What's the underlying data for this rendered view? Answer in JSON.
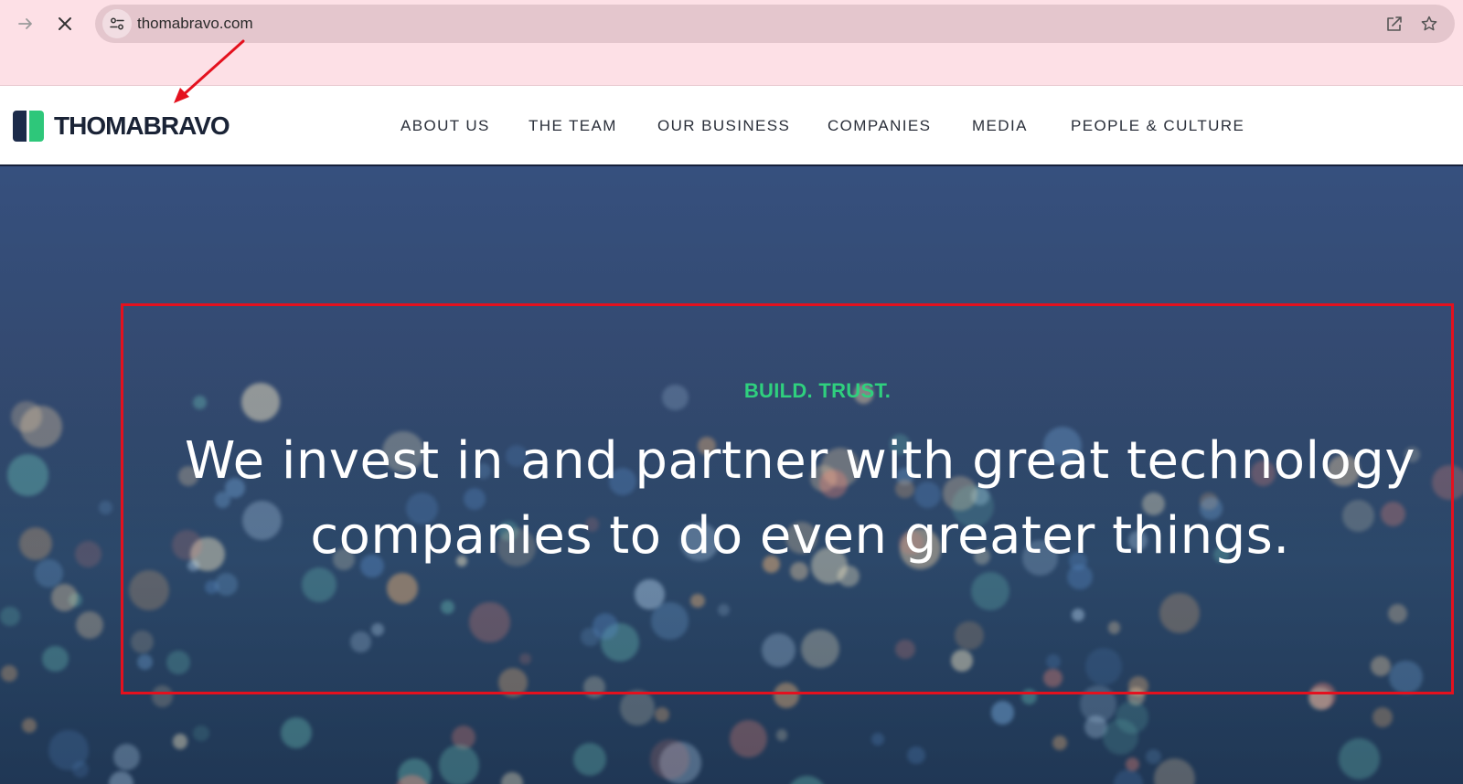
{
  "browser": {
    "url": "thomabravo.com"
  },
  "site": {
    "logo_text": "THOMABRAVO",
    "brand_colors": {
      "dark": "#1c2b4a",
      "green": "#2ec77a"
    },
    "nav": [
      {
        "label": "ABOUT US"
      },
      {
        "label": "THE TEAM"
      },
      {
        "label": "OUR BUSINESS"
      },
      {
        "label": "COMPANIES"
      },
      {
        "label": "MEDIA"
      },
      {
        "label": "PEOPLE & CULTURE"
      }
    ]
  },
  "hero": {
    "tagline": "BUILD. TRUST.",
    "headline_line1": "We invest in and partner with great technology",
    "headline_line2": "companies to do even greater things.",
    "tagline_color": "#2fd07e"
  },
  "annotations": {
    "highlight_color": "#e4111e"
  }
}
